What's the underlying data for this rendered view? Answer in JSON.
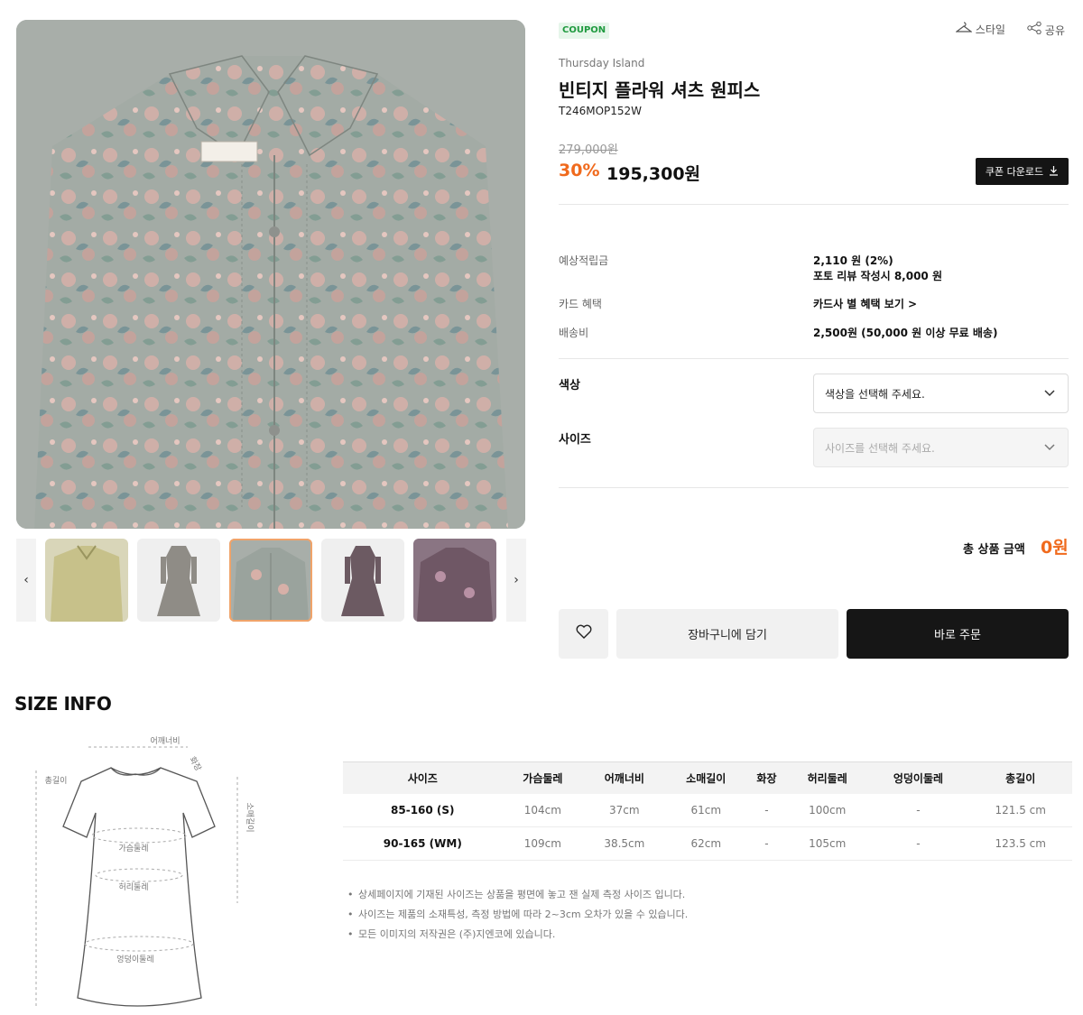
{
  "product": {
    "coupon_badge": "COUPON",
    "brand": "Thursday Island",
    "title": "빈티지 플라워 셔츠 원피스",
    "code": "T246MOP152W",
    "original_price": "279,000원",
    "discount": "30%",
    "price": "195,300원"
  },
  "top_actions": {
    "style_label": "스타일",
    "share_label": "공유"
  },
  "coupon_download_label": "쿠폰 다운로드",
  "info": [
    {
      "label": "예상적립금",
      "value": "2,110 원 (2%)",
      "value2": "포토 리뷰 작성시 8,000 원"
    },
    {
      "label": "카드 혜택",
      "value": "카드사 별 혜택 보기 >"
    },
    {
      "label": "배송비",
      "value": "2,500원 (50,000 원 이상 무료 배송)"
    }
  ],
  "options": {
    "color_label": "색상",
    "color_placeholder": "색상을 선택해 주세요.",
    "size_label": "사이즈",
    "size_placeholder": "사이즈를 선택해 주세요."
  },
  "total": {
    "label": "총 상품 금액",
    "value": "0원"
  },
  "buttons": {
    "cart": "장바구니에 담기",
    "buy": "바로 주문"
  },
  "thumbnails": [
    {
      "name": "yellow-floral",
      "color": "#c9c28a"
    },
    {
      "name": "gray-dress-full",
      "color": "#8f8c86"
    },
    {
      "name": "gray-floral-active",
      "color": "#9aa39d"
    },
    {
      "name": "purple-dress-full",
      "color": "#6c5a62"
    },
    {
      "name": "purple-floral",
      "color": "#6f5765"
    }
  ],
  "size_info": {
    "title": "SIZE INFO",
    "diagram_labels": {
      "shoulder": "어깨너비",
      "collar": "화장",
      "total_length": "총길이",
      "sleeve": "소매길이",
      "chest": "가슴둘레",
      "waist": "허리둘레",
      "hip": "엉덩이둘레"
    },
    "headers": [
      "사이즈",
      "가슴둘레",
      "어깨너비",
      "소매길이",
      "화장",
      "허리둘레",
      "엉덩이둘레",
      "총길이"
    ],
    "rows": [
      [
        "85-160 (S)",
        "104cm",
        "37cm",
        "61cm",
        "-",
        "100cm",
        "-",
        "121.5 cm"
      ],
      [
        "90-165 (WM)",
        "109cm",
        "38.5cm",
        "62cm",
        "-",
        "105cm",
        "-",
        "123.5 cm"
      ]
    ],
    "notes": [
      "상세페이지에 기재된 사이즈는 상품을 평면에 놓고 잰 실제 측정 사이즈 입니다.",
      "사이즈는 제품의 소재특성, 측정 방법에 따라 2~3cm 오차가 있을 수 있습니다.",
      "모든 이미지의 저작권은 (주)지엔코에 있습니다."
    ]
  },
  "colors": {
    "accent": "#f06a1d",
    "dark": "#161616",
    "coupon_green": "#1f9a3f"
  }
}
